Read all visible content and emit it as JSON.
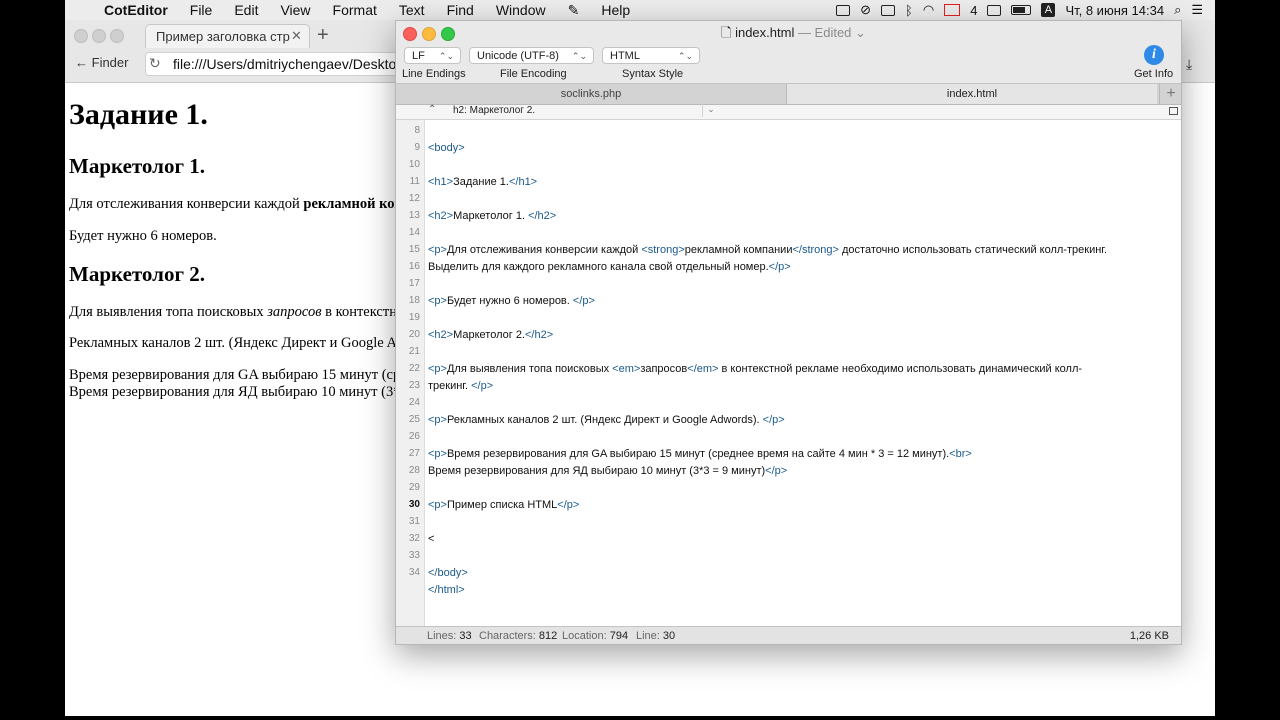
{
  "menubar": {
    "app": "CotEditor",
    "items": [
      "File",
      "Edit",
      "View",
      "Format",
      "Text",
      "Find",
      "Window",
      "Help"
    ],
    "mail_count": "4",
    "input_lang": "A",
    "datetime": "Чт, 8 июня  14:34"
  },
  "browser": {
    "tab_title": "Пример заголовка стр",
    "back_label": "Finder",
    "url": "file:///Users/dmitriychengaev/Desktop",
    "content": {
      "h1": "Задание 1.",
      "h2_1": "Маркетолог 1.",
      "p1_a": "Для отслеживания конверсии каждой ",
      "p1_b": "рекламной ком",
      "p2": "Будет нужно 6 номеров.",
      "h2_2": "Маркетолог 2.",
      "p3_a": "Для выявления топа поисковых ",
      "p3_b": "запросов",
      "p3_c": " в контекстн",
      "p4": "Рекламных каналов 2 шт. (Яндекс Директ и Google A",
      "p5_1": "Время резервирования для GA выбираю 15 минут (ср",
      "p5_2": "Время резервирования для ЯД выбираю 10 минут (3*"
    }
  },
  "editor": {
    "title": "index.html",
    "title_state": " — Edited",
    "toolbar": {
      "line_endings_value": "LF",
      "encoding_value": "Unicode (UTF-8)",
      "syntax_value": "HTML",
      "line_endings_label": "Line Endings",
      "encoding_label": "File Encoding",
      "syntax_label": "Syntax Style",
      "info_label": "Get Info",
      "info_glyph": "i"
    },
    "tabs": [
      "soclinks.php",
      "index.html"
    ],
    "navigator_section": "h2: Маркетолог 2.",
    "status": {
      "lines_key": "Lines:",
      "lines": "33",
      "chars_key": "Characters:",
      "chars": "812",
      "location_key": "Location:",
      "location": "794",
      "line_key": "Line:",
      "line": "30",
      "size": "1,26 KB"
    },
    "line_numbers": [
      "8",
      "9",
      "10",
      "11",
      "12",
      "13",
      "14",
      "15",
      "16",
      "17",
      "18",
      "19",
      "20",
      "21",
      "22",
      "23",
      "24",
      "25",
      "26",
      "27",
      "28",
      "29",
      "30",
      "31",
      "32",
      "33",
      "34"
    ],
    "current_line": "30",
    "code": {
      "l9_tag": "<body>",
      "l11_o": "<h1>",
      "l11_t": "Задание 1.",
      "l11_c": "</h1>",
      "l13_o": "<h2>",
      "l13_t": "Маркетолог 1. ",
      "l13_c": "</h2>",
      "l15_o": "<p>",
      "l15_t1": "Для отслеживания конверсии каждой ",
      "l15_so": "<strong>",
      "l15_t2": "рекламной компании",
      "l15_sc": "</strong>",
      "l15_t3": " достаточно использовать статический колл-трекинг.",
      "l15b_t": "Выделить для каждого рекламного канала свой отдельный номер.",
      "l15b_c": "</p>",
      "l17_o": "<p>",
      "l17_t": "Будет нужно 6 номеров. ",
      "l17_c": "</p>",
      "l19_o": "<h2>",
      "l19_t": "Маркетолог 2.",
      "l19_c": "</h2>",
      "l21_o": "<p>",
      "l21_t1": "Для выявления топа поисковых ",
      "l21_eo": "<em>",
      "l21_t2": "запросов",
      "l21_ec": "</em>",
      "l21_t3": " в контекстной рекламе необходимо использовать динамический колл-",
      "l21b_t": "трекинг. ",
      "l21b_c": "</p>",
      "l23_o": "<p>",
      "l23_t": "Рекламных каналов 2 шт. (Яндекс Директ и Google Adwords).  ",
      "l23_c": "</p>",
      "l25_o": "<p>",
      "l25_t": "Время резервирования для GA выбираю 15 минут (среднее время на сайте 4 мин * 3 = 12 минут).",
      "l25_br": "<br>",
      "l26_t": "Время резервирования для ЯД выбираю 10 минут (3*3 = 9 минут)",
      "l26_c": "</p>",
      "l28_o": "<p>",
      "l28_t": "Пример списка HTML",
      "l28_c": "</p>",
      "l30": "<",
      "l32": "</body>",
      "l33": "</html>"
    }
  },
  "colors": {
    "tag": "#1a5a8c",
    "close": "#fc605b",
    "minimize": "#fdbc40",
    "zoom": "#34c84a",
    "info": "#2e8ae6"
  }
}
